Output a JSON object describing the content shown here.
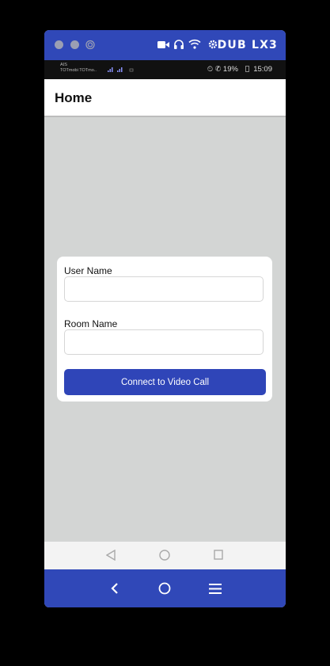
{
  "emulator": {
    "title": "DUB LX3",
    "accent": "#3048b8",
    "icons": [
      "window-close-dot",
      "window-min-dot",
      "fingerprint-icon",
      "video-icon",
      "headphones-icon",
      "wifi-icon",
      "gear-icon"
    ]
  },
  "status_bar": {
    "carrier_line1": "AIS",
    "carrier_line2": "TOTmobi TOTmo..",
    "battery": "19%",
    "time": "15:09"
  },
  "app": {
    "title": "Home"
  },
  "form": {
    "user_label": "User Name",
    "user_value": "",
    "room_label": "Room Name",
    "room_value": "",
    "connect_label": "Connect to Video Call",
    "button_color": "#2f45b8"
  },
  "nav": {
    "system_buttons": [
      "back-icon",
      "home-icon",
      "recents-icon"
    ],
    "emulator_buttons": [
      "back-icon",
      "home-icon",
      "menu-icon"
    ]
  }
}
